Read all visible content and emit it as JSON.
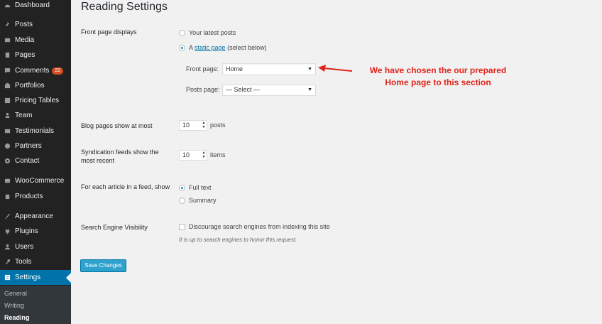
{
  "sidebar": {
    "items": [
      {
        "label": "Dashboard",
        "icon": "dashboard-icon"
      },
      {
        "label": "Posts",
        "icon": "pin-icon"
      },
      {
        "label": "Media",
        "icon": "media-icon"
      },
      {
        "label": "Pages",
        "icon": "pages-icon"
      },
      {
        "label": "Comments",
        "icon": "comment-icon",
        "badge": "22"
      },
      {
        "label": "Portfolios",
        "icon": "portfolio-icon"
      },
      {
        "label": "Pricing Tables",
        "icon": "pricing-icon"
      },
      {
        "label": "Team",
        "icon": "team-icon"
      },
      {
        "label": "Testimonials",
        "icon": "testimonial-icon"
      },
      {
        "label": "Partners",
        "icon": "partners-icon"
      },
      {
        "label": "Contact",
        "icon": "gear-icon"
      },
      {
        "label": "WooCommerce",
        "icon": "woocommerce-icon"
      },
      {
        "label": "Products",
        "icon": "products-icon"
      },
      {
        "label": "Appearance",
        "icon": "brush-icon"
      },
      {
        "label": "Plugins",
        "icon": "plugin-icon"
      },
      {
        "label": "Users",
        "icon": "users-icon"
      },
      {
        "label": "Tools",
        "icon": "wrench-icon"
      },
      {
        "label": "Settings",
        "icon": "settings-icon"
      }
    ],
    "submenu": [
      "General",
      "Writing",
      "Reading"
    ]
  },
  "page": {
    "title": "Reading Settings"
  },
  "front_page": {
    "label": "Front page displays",
    "option_latest": "Your latest posts",
    "option_static_prefix": "A",
    "option_static_link": "static page",
    "option_static_suffix": "(select below)",
    "front_page_label": "Front page:",
    "front_page_value": "Home",
    "posts_page_label": "Posts page:",
    "posts_page_value": "— Select —"
  },
  "blog_pages": {
    "label": "Blog pages show at most",
    "value": "10",
    "unit": "posts"
  },
  "syndication": {
    "label": "Syndication feeds show the most recent",
    "value": "10",
    "unit": "items"
  },
  "feed_article": {
    "label": "For each article in a feed, show",
    "option_full": "Full text",
    "option_summary": "Summary"
  },
  "search_engine": {
    "label": "Search Engine Visibility",
    "checkbox_label": "Discourage search engines from indexing this site",
    "description": "It is up to search engines to honor this request."
  },
  "save_button": "Save Changes",
  "annotation": {
    "line1": "We have chosen the our prepared",
    "line2": "Home page to this section"
  },
  "colors": {
    "sidebar_bg": "#222222",
    "active_menu": "#0073aa",
    "annotation_red": "#e2231a",
    "button_blue": "#2ea2cc"
  }
}
